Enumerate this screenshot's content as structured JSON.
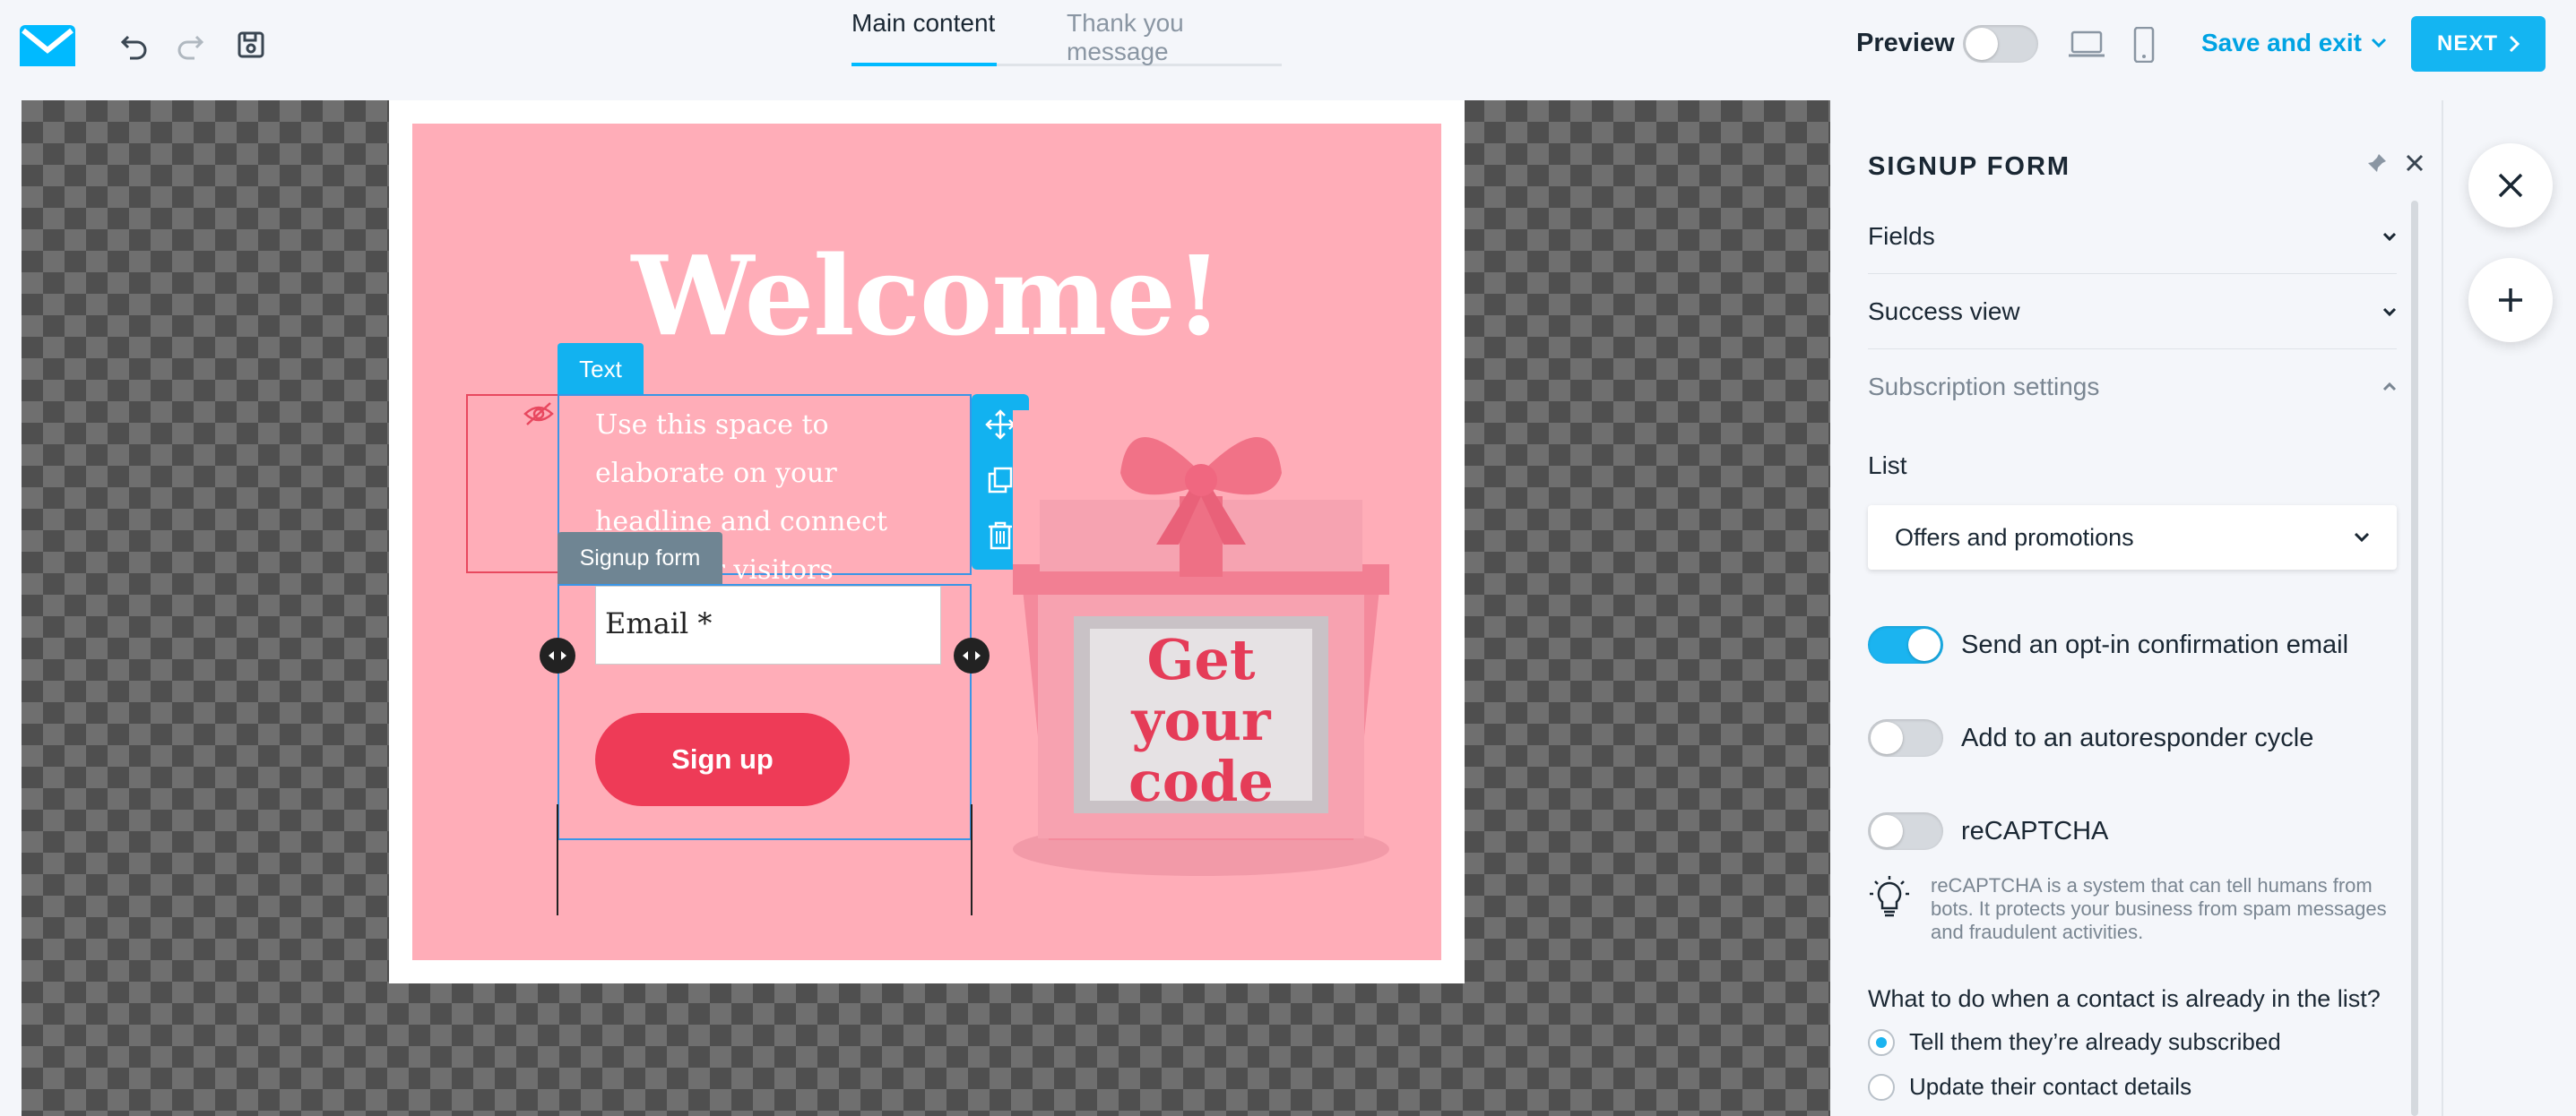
{
  "header": {
    "tabs": [
      {
        "label": "Main content",
        "active": true
      },
      {
        "label": "Thank you message",
        "active": false
      }
    ],
    "preview_label": "Preview",
    "preview_on": false,
    "save_exit_label": "Save and exit",
    "next_label": "NEXT",
    "icons": [
      "logo-envelope-icon",
      "undo-icon",
      "redo-icon",
      "save-icon",
      "desktop-icon",
      "mobile-icon"
    ]
  },
  "popup": {
    "headline": "Welcome!",
    "text_tag": "Text",
    "body_text": "Use this space to elaborate on your headline and connect with your visitors",
    "signup_tag": "Signup form",
    "email_placeholder": "Email *",
    "signup_button": "Sign up",
    "gift_text": [
      "Get",
      "your",
      "code"
    ],
    "colors": {
      "background": "#ffadb8",
      "button": "#ee3b57",
      "accent": "#12b2f0"
    }
  },
  "panel": {
    "title": "SIGNUP FORM",
    "accordions": [
      {
        "label": "Fields",
        "expanded": false
      },
      {
        "label": "Success view",
        "expanded": false
      },
      {
        "label": "Subscription settings",
        "expanded": true
      }
    ],
    "list_label": "List",
    "list_value": "Offers and promotions",
    "toggles": [
      {
        "label": "Send an opt-in confirmation email",
        "on": true
      },
      {
        "label": "Add to an autoresponder cycle",
        "on": false
      },
      {
        "label": "reCAPTCHA",
        "on": false
      }
    ],
    "hint": "reCAPTCHA is a system that can tell humans from bots. It protects your business from spam messages and fraudulent activities.",
    "question": "What to do when a contact is already in the list?",
    "radios": [
      {
        "label": "Tell them they’re already subscribed",
        "checked": true
      },
      {
        "label": "Update their contact details",
        "checked": false
      }
    ]
  }
}
